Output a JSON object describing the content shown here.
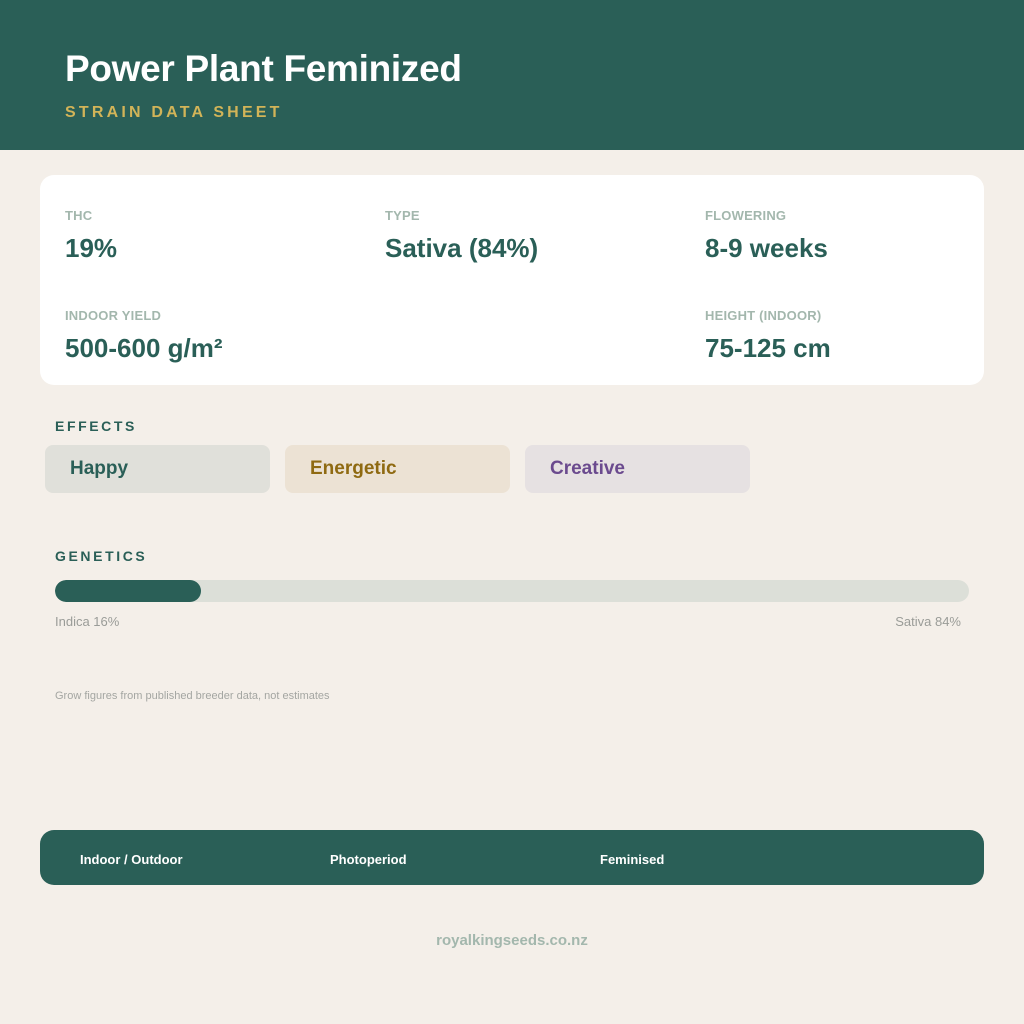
{
  "header": {
    "title": "Power Plant Feminized",
    "subtitle": "STRAIN DATA SHEET"
  },
  "stats": [
    {
      "label": "THC",
      "value": "19%"
    },
    {
      "label": "TYPE",
      "value": "Sativa (84%)"
    },
    {
      "label": "FLOWERING",
      "value": "8-9 weeks"
    },
    {
      "label": "INDOOR YIELD",
      "value": "500-600 g/m²"
    },
    {
      "label": "HEIGHT (INDOOR)",
      "value": "75-125 cm"
    }
  ],
  "effects": {
    "heading": "EFFECTS",
    "items": [
      {
        "label": "Happy",
        "color": "#2a5f57",
        "background": "#e0e0da"
      },
      {
        "label": "Energetic",
        "color": "#8f6a12",
        "background": "#ece2d4"
      },
      {
        "label": "Creative",
        "color": "#6b4a8e",
        "background": "#e6e1e2"
      }
    ]
  },
  "genetics": {
    "heading": "GENETICS",
    "indica_percent": 16,
    "sativa_percent": 84,
    "indica_label": "Indica 16%",
    "sativa_label": "Sativa 84%"
  },
  "footnote": "Grow figures from published breeder data, not estimates",
  "footer": {
    "items": [
      "Indoor / Outdoor",
      "Photoperiod",
      "Feminised"
    ]
  },
  "website": "royalkingseeds.co.nz",
  "colors": {
    "primary": "#2a5f57",
    "accent": "#d2b458",
    "background": "#f4efe9"
  }
}
